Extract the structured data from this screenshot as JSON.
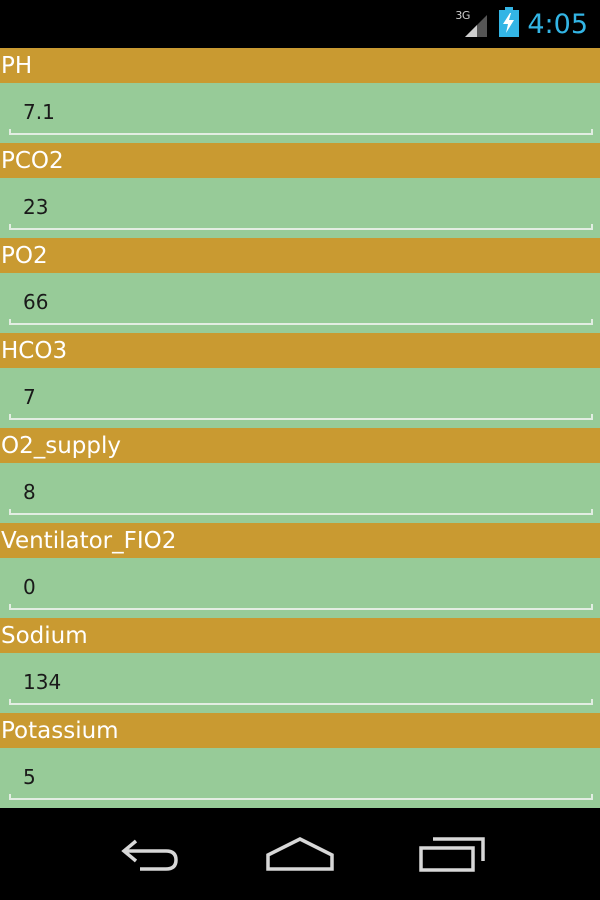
{
  "status_bar": {
    "network_type": "3G",
    "time": "4:05",
    "icons": [
      "signal-icon",
      "battery-charging-icon"
    ],
    "clock_color": "#33b5e5"
  },
  "colors": {
    "label_background": "#c99a31",
    "field_background": "#97cb98"
  },
  "fields": [
    {
      "label": "PH",
      "value": "7.1"
    },
    {
      "label": "PCO2",
      "value": "23"
    },
    {
      "label": "PO2",
      "value": "66"
    },
    {
      "label": "HCO3",
      "value": "7"
    },
    {
      "label": "O2_supply",
      "value": "8"
    },
    {
      "label": "Ventilator_FIO2",
      "value": "0"
    },
    {
      "label": "Sodium",
      "value": "134"
    },
    {
      "label": "Potassium",
      "value": "5"
    }
  ],
  "nav_bar": {
    "icons": [
      "back-icon",
      "home-icon",
      "recent-apps-icon"
    ]
  }
}
